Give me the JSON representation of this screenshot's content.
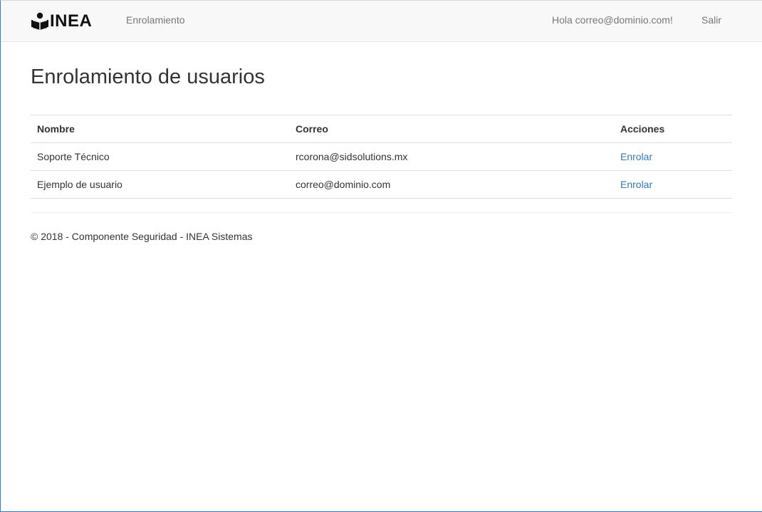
{
  "navbar": {
    "brand": "INEA",
    "brand_icon": "reader-icon",
    "nav_link": "Enrolamiento",
    "greeting": "Hola correo@dominio.com!",
    "logout": "Salir"
  },
  "main": {
    "title": "Enrolamiento de usuarios",
    "table": {
      "headers": [
        "Nombre",
        "Correo",
        "Acciones"
      ],
      "rows": [
        {
          "nombre": "Soporte Técnico",
          "correo": "rcorona@sidsolutions.mx",
          "accion": "Enrolar"
        },
        {
          "nombre": "Ejemplo de usuario",
          "correo": "correo@dominio.com",
          "accion": "Enrolar"
        }
      ]
    }
  },
  "footer": {
    "text": "© 2018 - Componente Seguridad - INEA Sistemas"
  },
  "colors": {
    "link": "#337ab7",
    "navbar_bg": "#f8f8f8",
    "nav_text": "#777777"
  }
}
